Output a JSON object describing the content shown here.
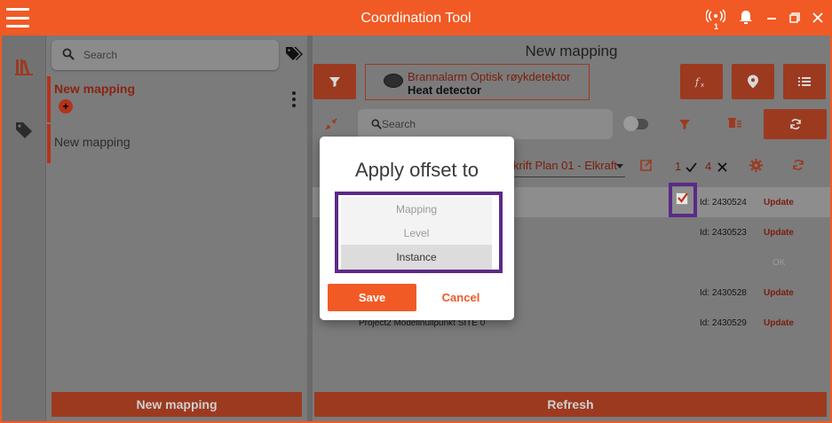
{
  "app": {
    "title": "Coordination Tool",
    "notification_count": "1"
  },
  "colors": {
    "accent": "#f15a24",
    "dark_accent": "#9c3a20",
    "highlight": "#5b2a86"
  },
  "list_panel": {
    "search_placeholder": "Search",
    "items": [
      {
        "label": "New mapping",
        "selected": true
      },
      {
        "label": "New mapping",
        "selected": false
      }
    ],
    "new_button": "New mapping"
  },
  "main": {
    "title": "New mapping",
    "element": {
      "name": "Brannalarm Optisk røykdetektor",
      "type": "Heat detector"
    },
    "search_placeholder": "Search",
    "plan_select": "krift Plan 01 - Elkraft",
    "count_checked": "1",
    "count_unchecked": "4",
    "rows": [
      {
        "id": "Id: 2430524",
        "action": "Update",
        "label": ""
      },
      {
        "id": "Id: 2430523",
        "action": "Update",
        "label": ""
      },
      {
        "id": "",
        "action": "OK",
        "label": ""
      },
      {
        "id": "Id: 2430528",
        "action": "Update",
        "label": ""
      },
      {
        "id": "Id: 2430529",
        "action": "Update",
        "label": "Project2 Modellnullpunkt SITE 0"
      }
    ],
    "refresh_button": "Refresh"
  },
  "modal": {
    "title": "Apply offset to",
    "options": [
      "Mapping",
      "Level",
      "Instance"
    ],
    "selected_option": "Instance",
    "save": "Save",
    "cancel": "Cancel"
  }
}
